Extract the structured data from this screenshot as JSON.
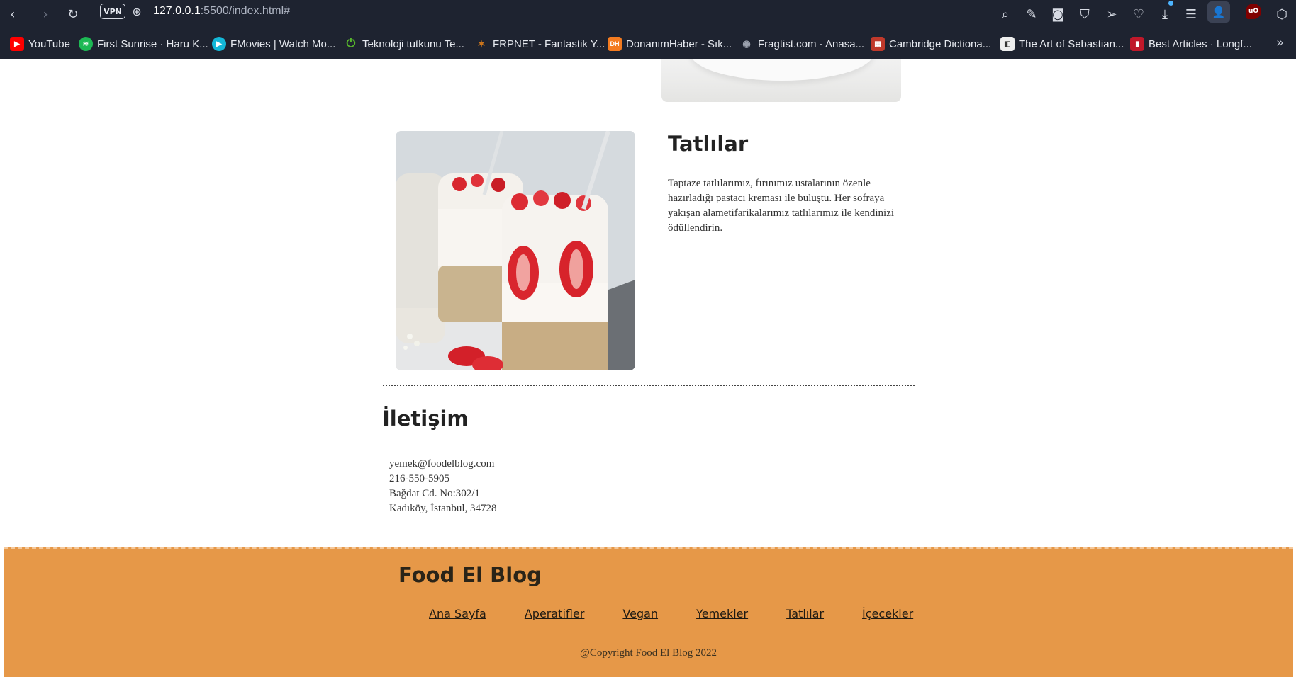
{
  "browser": {
    "url_host": "127.0.0.1",
    "url_rest": ":5500/index.html#",
    "vpn_label": "VPN",
    "bookmarks": [
      {
        "label": "YouTube",
        "color": "#ff0000",
        "glyph": "▶"
      },
      {
        "label": "First Sunrise · Haru K...",
        "color": "#1db954",
        "glyph": "≋"
      },
      {
        "label": "FMovies | Watch Mo...",
        "color": "#14b8d8",
        "glyph": "▶"
      },
      {
        "label": "Teknoloji tutkunu Te...",
        "color": "#57b52c",
        "glyph": "⏻"
      },
      {
        "label": "FRPNET - Fantastik Y...",
        "color": "#c9741c",
        "glyph": "✶"
      },
      {
        "label": "DonanımHaber - Sık...",
        "color": "#f47b20",
        "glyph": "DH"
      },
      {
        "label": "Fragtist.com - Anasa...",
        "color": "#5a6070",
        "glyph": "◉"
      },
      {
        "label": "Cambridge Dictiona...",
        "color": "#c0392b",
        "glyph": "▦"
      },
      {
        "label": "The Art of Sebastian...",
        "color": "#eeeeee",
        "glyph": "◧"
      },
      {
        "label": "Best Articles · Longf...",
        "color": "#c0182a",
        "glyph": "▮"
      }
    ]
  },
  "dessert": {
    "title": "Tatlılar",
    "description": "Taptaze tatlılarımız, fırınımız ustalarının özenle hazırladığı pastacı kreması ile buluştu. Her sofraya yakışan alametifarikalarımız tatlılarımız ile kendinizi ödüllendirin."
  },
  "contact": {
    "title": "İletişim",
    "lines": [
      "yemek@foodelblog.com",
      "216-550-5905",
      "Bağdat Cd. No:302/1",
      "Kadıköy, İstanbul, 34728"
    ]
  },
  "footer": {
    "title": "Food El Blog",
    "nav": [
      "Ana Sayfa",
      "Aperatifler",
      "Vegan",
      "Yemekler",
      "Tatlılar",
      "İçecekler"
    ],
    "copyright": "@Copyright Food El Blog 2022",
    "bg_color": "#e69848"
  }
}
